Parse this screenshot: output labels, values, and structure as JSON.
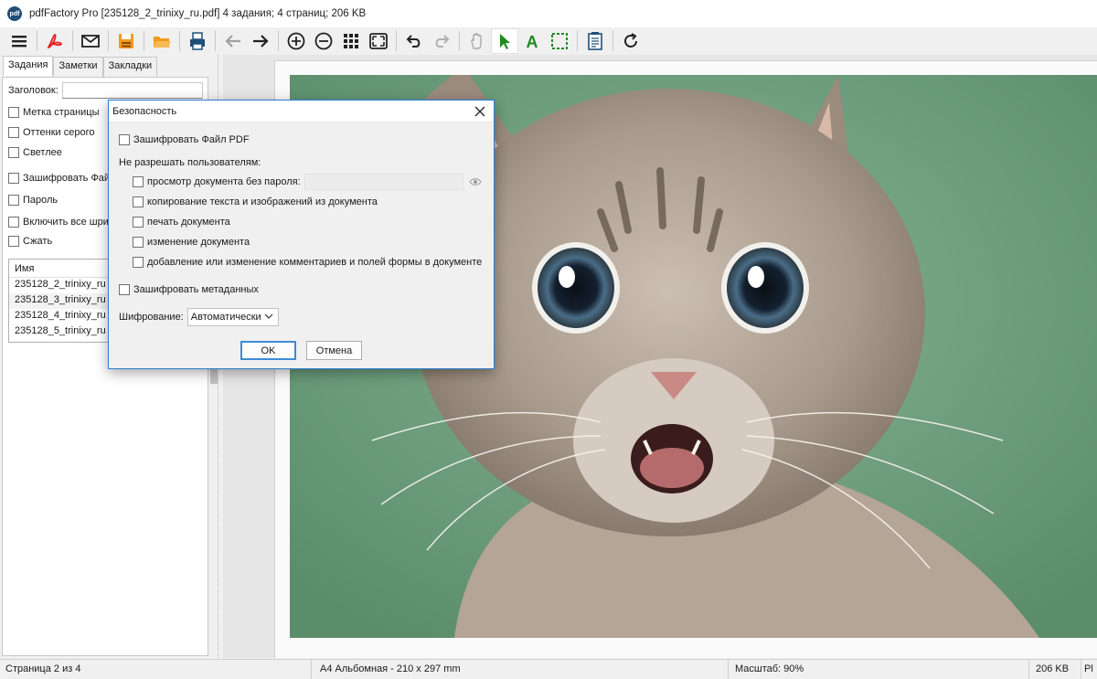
{
  "window": {
    "title": "pdfFactory Pro [235128_2_trinixy_ru.pdf] 4 задания; 4 страниц; 206 KB",
    "icon_text": "pdf"
  },
  "toolbar": {
    "icons": [
      "menu-icon",
      "pdf-icon",
      "mail-icon",
      "save-icon",
      "open-folder-icon",
      "print-icon",
      "back-arrow-icon",
      "forward-arrow-icon",
      "zoom-in-icon",
      "zoom-out-icon",
      "thumbnails-icon",
      "fit-page-icon",
      "undo-icon",
      "redo-icon",
      "hand-tool-icon",
      "select-arrow-icon",
      "text-tool-icon",
      "marquee-select-icon",
      "notes-icon",
      "refresh-icon"
    ]
  },
  "left_panel": {
    "tabs": [
      "Задания",
      "Заметки",
      "Закладки"
    ],
    "title_label": "Заголовок:",
    "checkboxes": [
      "Метка страницы",
      "Оттенки серого",
      "Светлее",
      "Зашифровать Файл",
      "Пароль",
      "Включить все шриф",
      "Сжать"
    ],
    "list_header": "Имя",
    "list_items": [
      "235128_2_trinixy_ru",
      "235128_3_trinixy_ru",
      "235128_4_trinixy_ru",
      "235128_5_trinixy_ru"
    ]
  },
  "status_bar": {
    "page": "Страница 2 из 4",
    "format": "A4 Альбомная - 210 x 297 mm",
    "zoom": "Масштаб: 90%",
    "size": "206 KB",
    "extra": "Pl"
  },
  "dialog": {
    "title": "Безопасность",
    "encrypt_pdf": "Зашифровать Файл PDF",
    "disallow_heading": "Не разрешать пользователям:",
    "options": [
      "просмотр документа без пароля:",
      "копирование текста и изображений из документа",
      "печать документа",
      "изменение документа",
      "добавление или изменение комментариев и полей формы в документе"
    ],
    "encrypt_metadata": "Зашифровать метаданных",
    "encryption_label": "Шифрование:",
    "encryption_value": "Автоматически",
    "ok": "OK",
    "cancel": "Отмена"
  },
  "colors": {
    "accent": "#2a7fd4",
    "photo_background": "#6f9f80"
  }
}
